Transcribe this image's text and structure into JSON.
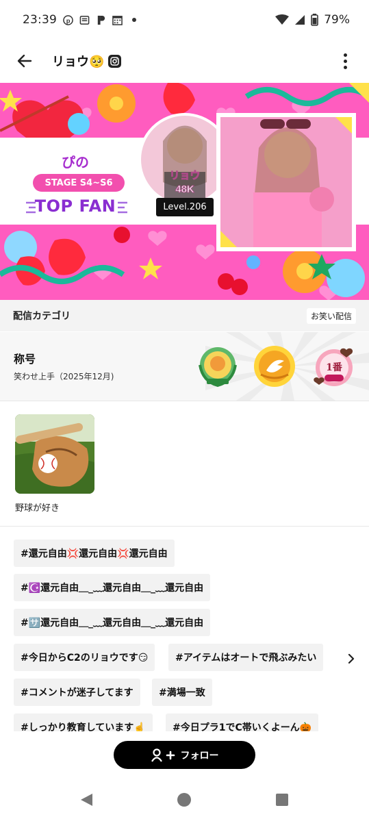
{
  "status_bar": {
    "time": "23:39",
    "battery": "79%",
    "icons": [
      "notification-p-icon",
      "news-icon",
      "notification-p2-icon",
      "calendar-icon",
      "dot-icon",
      "wifi-icon",
      "signal-icon",
      "battery-icon"
    ]
  },
  "app_bar": {
    "back_icon": "arrow-left-icon",
    "title": "リョウ🥺",
    "title_icon": "instagram-icon",
    "more_icon": "more-vertical-icon"
  },
  "banner": {
    "fan_name": "ぴの",
    "stage": "STAGE S4~S6",
    "top_fan": "TOP FAN",
    "level": "Level.206"
  },
  "category": {
    "label": "配信カテゴリ",
    "value": "お笑い配信"
  },
  "title_section": {
    "label": "称号",
    "value": "笑わせ上手（2025年12月)",
    "badges": [
      "award-2025-badge",
      "warawase-jozu-badge",
      "choco-1ban-2026-badge"
    ]
  },
  "interests": [
    {
      "label": "野球が好き",
      "image": "baseball-glove-image"
    }
  ],
  "tags": [
    "#還元自由💢還元自由💢還元自由",
    "#☪️還元自由＿_﹏還元自由＿_﹏還元自由",
    "#🈂️還元自由＿_﹏還元自由＿_﹏還元自由",
    "#今日からC2のリョウです😏",
    "#アイテムはオートで飛ぶみたい",
    "#コメントが迷子してます",
    "#満場一致",
    "#しっかり教育しています☝️",
    "#今日プラ1でC帯いくよーん🎃"
  ],
  "follow_button": {
    "label": "フォロー",
    "icon": "person-add-icon"
  },
  "nav_bar": {
    "icons": [
      "nav-back-icon",
      "nav-home-icon",
      "nav-recents-icon"
    ]
  },
  "colors": {
    "banner_pink": "#ff4fb8",
    "stage_pill": "#f24fae",
    "top_fan_purple": "#8a2ed1",
    "tag_bg": "#f2f2f2",
    "follow_bg": "#000000"
  }
}
